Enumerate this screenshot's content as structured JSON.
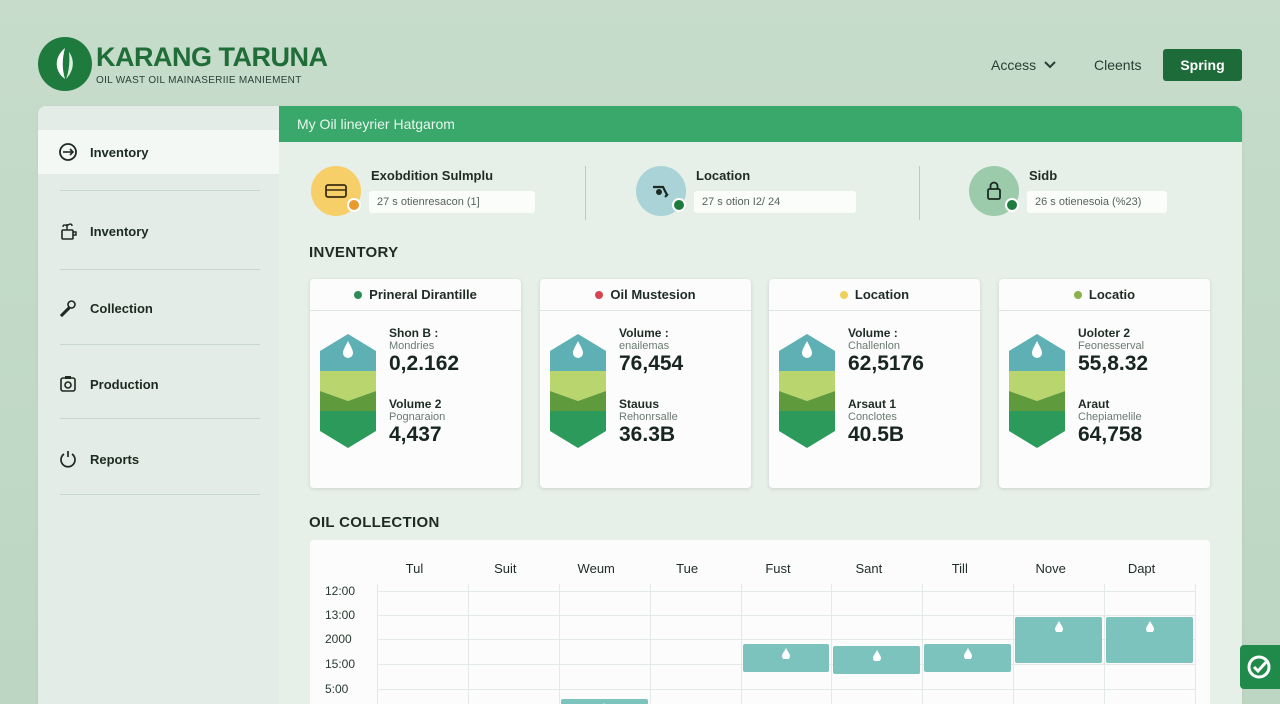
{
  "brand": {
    "title": "KARANG TARUNA",
    "subtitle": "OIL WAST OIL MAINASERIIE MANIEMENT"
  },
  "nav": {
    "access_label": "Access",
    "clients_label": "Cleents",
    "spring_label": "Spring"
  },
  "banner": {
    "text": "My Oil lineyrier Hatgarom"
  },
  "sidebar": {
    "items": [
      {
        "label": "Inventory",
        "icon": "refresh-circle-icon",
        "active": true
      },
      {
        "label": "Inventory",
        "icon": "plant-pot-icon",
        "active": false
      },
      {
        "label": "Collection",
        "icon": "dropper-icon",
        "active": false
      },
      {
        "label": "Production",
        "icon": "camera-box-icon",
        "active": false
      },
      {
        "label": "Reports",
        "icon": "power-icon",
        "active": false
      }
    ]
  },
  "stats": [
    {
      "title": "Exobdition Sulmplu",
      "value": "27 s otienresacon (1]",
      "icon": "storage-box-icon",
      "circle_color": "#f6cf69",
      "badge_color": "#e89a2c"
    },
    {
      "title": "Location",
      "value": "27 s otion I2/ 24",
      "icon": "pump-icon",
      "circle_color": "#a9d3d6",
      "badge_color": "#1f7a3e"
    },
    {
      "title": "Sidb",
      "value": "26 s otienesoia (%23)",
      "icon": "lock-icon",
      "circle_color": "#9ccbab",
      "badge_color": "#1f7a3e"
    }
  ],
  "inventory": {
    "title": "INVENTORY",
    "cards": [
      {
        "name": "Prineral Dirantille",
        "dot_color": "#2e8b57",
        "m1_label": "Shon B :",
        "m1_sub": "Mondries",
        "m1_value": "0,2.162",
        "m2_label": "Volume 2",
        "m2_sub": "Pognaraion",
        "m2_value": "4,437"
      },
      {
        "name": "Oil Mustesion",
        "dot_color": "#d64550",
        "m1_label": "Volume :",
        "m1_sub": "enailemas",
        "m1_value": "76,454",
        "m2_label": "Stauus",
        "m2_sub": "Rehonrsalle",
        "m2_value": "36.3B"
      },
      {
        "name": "Location",
        "dot_color": "#f0cf5a",
        "m1_label": "Volume :",
        "m1_sub": "Challenlon",
        "m1_value": "62,5176",
        "m2_label": "Arsaut 1",
        "m2_sub": "Conclotes",
        "m2_value": "40.5B"
      },
      {
        "name": "Locatio",
        "dot_color": "#8bb24a",
        "m1_label": "Uoloter 2",
        "m1_sub": "Feonesserval",
        "m1_value": "55,8.32",
        "m2_label": "Araut",
        "m2_sub": "Chepiamelile",
        "m2_value": "64,758"
      }
    ]
  },
  "collection": {
    "title": "OIL COLLECTION",
    "days": [
      "Tul",
      "Suit",
      "Weum",
      "Tue",
      "Fust",
      "Sant",
      "Till",
      "Nove",
      "Dapt"
    ],
    "y_ticks": [
      "12:00",
      "13:00",
      "2000",
      "15:00",
      "5:00"
    ],
    "bar_color": "#7cc3be"
  },
  "chart_data": {
    "type": "bar",
    "categories": [
      "Tul",
      "Suit",
      "Weum",
      "Tue",
      "Fust",
      "Sant",
      "Till",
      "Nove",
      "Dapt"
    ],
    "values": [
      null,
      null,
      0.1,
      null,
      0.6,
      0.58,
      0.6,
      0.85,
      0.85
    ],
    "y_tick_labels": [
      "12:00",
      "13:00",
      "2000",
      "15:00",
      "5:00"
    ],
    "title": "OIL COLLECTION",
    "grid": true
  },
  "corner": {
    "icon": "check-circle-icon"
  }
}
